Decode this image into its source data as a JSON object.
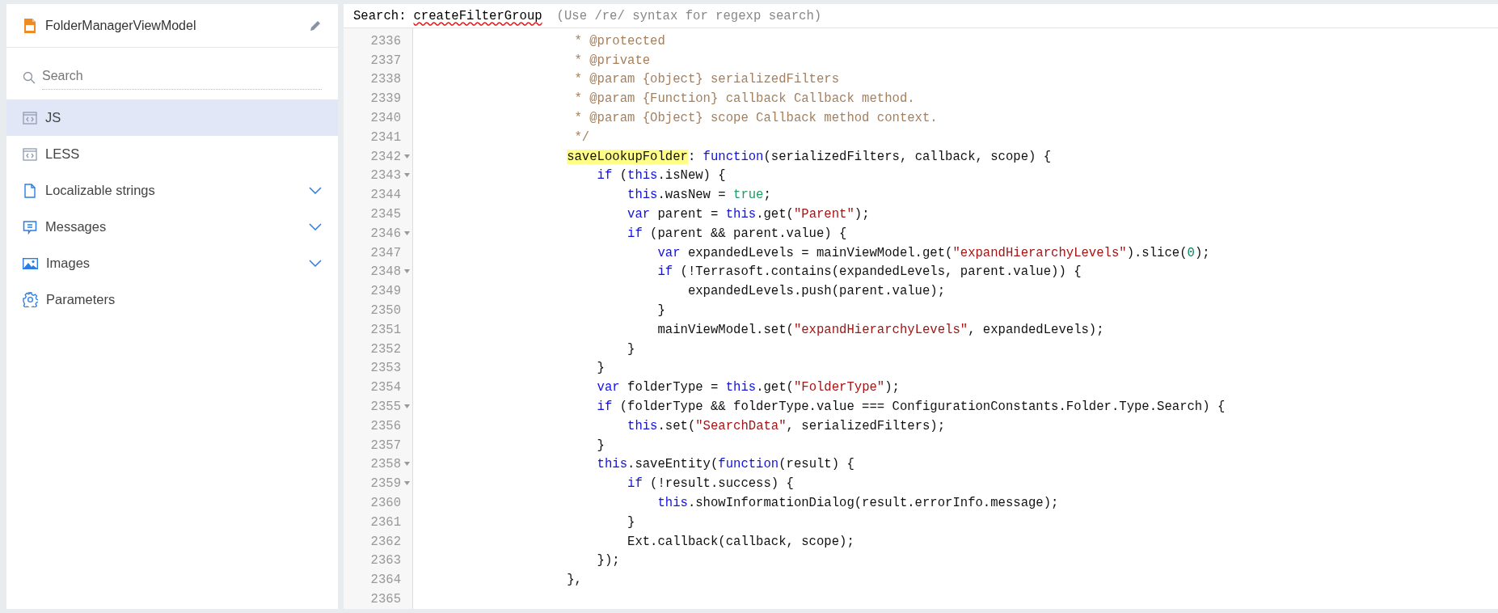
{
  "sidebar": {
    "title": "FolderManagerViewModel",
    "search": {
      "placeholder": "Search"
    },
    "items": [
      {
        "label": "JS",
        "selected": true,
        "expandable": false
      },
      {
        "label": "LESS",
        "selected": false,
        "expandable": false
      },
      {
        "label": "Localizable strings",
        "selected": false,
        "expandable": true
      },
      {
        "label": "Messages",
        "selected": false,
        "expandable": true
      },
      {
        "label": "Images",
        "selected": false,
        "expandable": true
      },
      {
        "label": "Parameters",
        "selected": false,
        "expandable": false
      }
    ]
  },
  "editor": {
    "search": {
      "label": "Search:",
      "value": "createFilterGroup",
      "hint": "(Use /re/ syntax for regexp search)"
    },
    "lines": [
      {
        "number": "2336",
        "foldable": false,
        "tokens": [
          {
            "kind": "comment",
            "text": "                     * @protected"
          }
        ]
      },
      {
        "number": "2337",
        "foldable": false,
        "tokens": [
          {
            "kind": "comment",
            "text": "                     * @private"
          }
        ]
      },
      {
        "number": "2338",
        "foldable": false,
        "tokens": [
          {
            "kind": "comment",
            "text": "                     * @param {object} serializedFilters"
          }
        ]
      },
      {
        "number": "2339",
        "foldable": false,
        "tokens": [
          {
            "kind": "comment",
            "text": "                     * @param {Function} callback Callback method."
          }
        ]
      },
      {
        "number": "2340",
        "foldable": false,
        "tokens": [
          {
            "kind": "comment",
            "text": "                     * @param {Object} scope Callback method context."
          }
        ]
      },
      {
        "number": "2341",
        "foldable": false,
        "tokens": [
          {
            "kind": "comment",
            "text": "                     */"
          }
        ]
      },
      {
        "number": "2342",
        "foldable": true,
        "tokens": [
          {
            "kind": "match",
            "text": "                    saveLookupFolder"
          },
          {
            "kind": "plain",
            "text": ": "
          },
          {
            "kind": "keyword",
            "text": "function"
          },
          {
            "kind": "plain",
            "text": "(serializedFilters, callback, scope) {"
          }
        ]
      },
      {
        "number": "2343",
        "foldable": true,
        "tokens": [
          {
            "kind": "keyword",
            "text": "                        if"
          },
          {
            "kind": "plain",
            "text": " ("
          },
          {
            "kind": "keyword",
            "text": "this"
          },
          {
            "kind": "plain",
            "text": ".isNew) {"
          }
        ]
      },
      {
        "number": "2344",
        "foldable": false,
        "tokens": [
          {
            "kind": "keyword",
            "text": "                            this"
          },
          {
            "kind": "plain",
            "text": ".wasNew = "
          },
          {
            "kind": "atom",
            "text": "true"
          },
          {
            "kind": "plain",
            "text": ";"
          }
        ]
      },
      {
        "number": "2345",
        "foldable": false,
        "tokens": [
          {
            "kind": "keyword",
            "text": "                            var"
          },
          {
            "kind": "plain",
            "text": " parent = "
          },
          {
            "kind": "keyword",
            "text": "this"
          },
          {
            "kind": "plain",
            "text": ".get("
          },
          {
            "kind": "string",
            "text": "\"Parent\""
          },
          {
            "kind": "plain",
            "text": ");"
          }
        ]
      },
      {
        "number": "2346",
        "foldable": true,
        "tokens": [
          {
            "kind": "keyword",
            "text": "                            if"
          },
          {
            "kind": "plain",
            "text": " (parent && parent.value) {"
          }
        ]
      },
      {
        "number": "2347",
        "foldable": false,
        "tokens": [
          {
            "kind": "keyword",
            "text": "                                var"
          },
          {
            "kind": "plain",
            "text": " expandedLevels = mainViewModel.get("
          },
          {
            "kind": "string",
            "text": "\"expandHierarchyLevels\""
          },
          {
            "kind": "plain",
            "text": ").slice("
          },
          {
            "kind": "number",
            "text": "0"
          },
          {
            "kind": "plain",
            "text": ");"
          }
        ]
      },
      {
        "number": "2348",
        "foldable": true,
        "tokens": [
          {
            "kind": "keyword",
            "text": "                                if"
          },
          {
            "kind": "plain",
            "text": " (!Terrasoft.contains(expandedLevels, parent.value)) {"
          }
        ]
      },
      {
        "number": "2349",
        "foldable": false,
        "tokens": [
          {
            "kind": "plain",
            "text": "                                    expandedLevels.push(parent.value);"
          }
        ]
      },
      {
        "number": "2350",
        "foldable": false,
        "tokens": [
          {
            "kind": "plain",
            "text": "                                }"
          }
        ]
      },
      {
        "number": "2351",
        "foldable": false,
        "tokens": [
          {
            "kind": "plain",
            "text": "                                mainViewModel.set("
          },
          {
            "kind": "string",
            "text": "\"expandHierarchyLevels\""
          },
          {
            "kind": "plain",
            "text": ", expandedLevels);"
          }
        ]
      },
      {
        "number": "2352",
        "foldable": false,
        "tokens": [
          {
            "kind": "plain",
            "text": "                            }"
          }
        ]
      },
      {
        "number": "2353",
        "foldable": false,
        "tokens": [
          {
            "kind": "plain",
            "text": "                        }"
          }
        ]
      },
      {
        "number": "2354",
        "foldable": false,
        "tokens": [
          {
            "kind": "keyword",
            "text": "                        var"
          },
          {
            "kind": "plain",
            "text": " folderType = "
          },
          {
            "kind": "keyword",
            "text": "this"
          },
          {
            "kind": "plain",
            "text": ".get("
          },
          {
            "kind": "string",
            "text": "\"FolderType\""
          },
          {
            "kind": "plain",
            "text": ");"
          }
        ]
      },
      {
        "number": "2355",
        "foldable": true,
        "tokens": [
          {
            "kind": "keyword",
            "text": "                        if"
          },
          {
            "kind": "plain",
            "text": " (folderType && folderType.value === ConfigurationConstants.Folder.Type.Search) {"
          }
        ]
      },
      {
        "number": "2356",
        "foldable": false,
        "tokens": [
          {
            "kind": "keyword",
            "text": "                            this"
          },
          {
            "kind": "plain",
            "text": ".set("
          },
          {
            "kind": "string",
            "text": "\"SearchData\""
          },
          {
            "kind": "plain",
            "text": ", serializedFilters);"
          }
        ]
      },
      {
        "number": "2357",
        "foldable": false,
        "tokens": [
          {
            "kind": "plain",
            "text": "                        }"
          }
        ]
      },
      {
        "number": "2358",
        "foldable": true,
        "tokens": [
          {
            "kind": "keyword",
            "text": "                        this"
          },
          {
            "kind": "plain",
            "text": ".saveEntity("
          },
          {
            "kind": "keyword",
            "text": "function"
          },
          {
            "kind": "plain",
            "text": "(result) {"
          }
        ]
      },
      {
        "number": "2359",
        "foldable": true,
        "tokens": [
          {
            "kind": "keyword",
            "text": "                            if"
          },
          {
            "kind": "plain",
            "text": " (!result.success) {"
          }
        ]
      },
      {
        "number": "2360",
        "foldable": false,
        "tokens": [
          {
            "kind": "keyword",
            "text": "                                this"
          },
          {
            "kind": "plain",
            "text": ".showInformationDialog(result.errorInfo.message);"
          }
        ]
      },
      {
        "number": "2361",
        "foldable": false,
        "tokens": [
          {
            "kind": "plain",
            "text": "                            }"
          }
        ]
      },
      {
        "number": "2362",
        "foldable": false,
        "tokens": [
          {
            "kind": "plain",
            "text": "                            Ext.callback(callback, scope);"
          }
        ]
      },
      {
        "number": "2363",
        "foldable": false,
        "tokens": [
          {
            "kind": "plain",
            "text": "                        });"
          }
        ]
      },
      {
        "number": "2364",
        "foldable": false,
        "tokens": [
          {
            "kind": "plain",
            "text": "                    },"
          }
        ]
      },
      {
        "number": "2365",
        "foldable": false
      }
    ]
  }
}
